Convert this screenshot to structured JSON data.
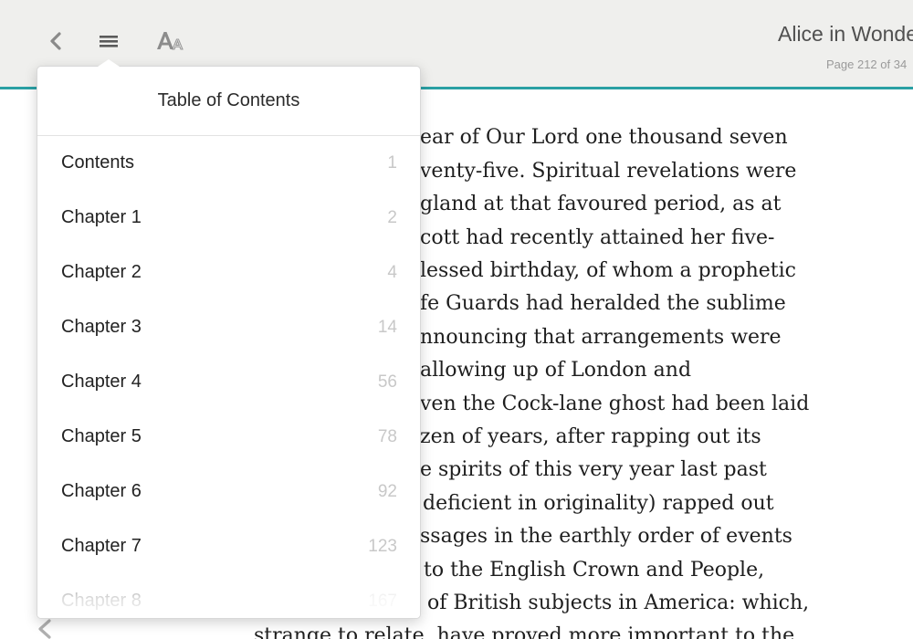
{
  "toolbar": {
    "book_title": "Alice in Wonderland",
    "page_indicator": "Page 212 of 34",
    "back_icon": "chevron-left-icon",
    "toc_icon": "hamburger-menu-icon",
    "font_icon": "font-size-icon",
    "accent_color": "#2aa0a4"
  },
  "toc": {
    "title": "Table of Contents",
    "items": [
      {
        "label": "Contents",
        "page": "1"
      },
      {
        "label": "Chapter 1",
        "page": "2"
      },
      {
        "label": "Chapter 2",
        "page": "4"
      },
      {
        "label": "Chapter 3",
        "page": "14"
      },
      {
        "label": "Chapter 4",
        "page": "56"
      },
      {
        "label": "Chapter 5",
        "page": "78"
      },
      {
        "label": "Chapter 6",
        "page": "92"
      },
      {
        "label": "Chapter 7",
        "page": "123"
      },
      {
        "label": "Chapter 8",
        "page": "167"
      }
    ]
  },
  "page": {
    "lines": [
      "ear of Our Lord one thousand seven",
      "venty-five. Spiritual revelations were",
      "gland at that favoured period, as at",
      "cott had recently attained her five-",
      "lessed birthday, of whom a prophetic",
      "fe Guards had heralded the sublime",
      "nnouncing that arrangements were",
      "allowing up of London and",
      "ven the Cock-lane ghost had been laid",
      "zen of years, after rapping out its",
      "e spirits of this very year last past",
      "deficient in originality) rapped out",
      "ssages in the earthly order of events",
      "to the English Crown and People,",
      "of British subjects in America: which,",
      "strange to relate, have proved more important to the"
    ],
    "prev_icon": "chevron-left-icon"
  }
}
